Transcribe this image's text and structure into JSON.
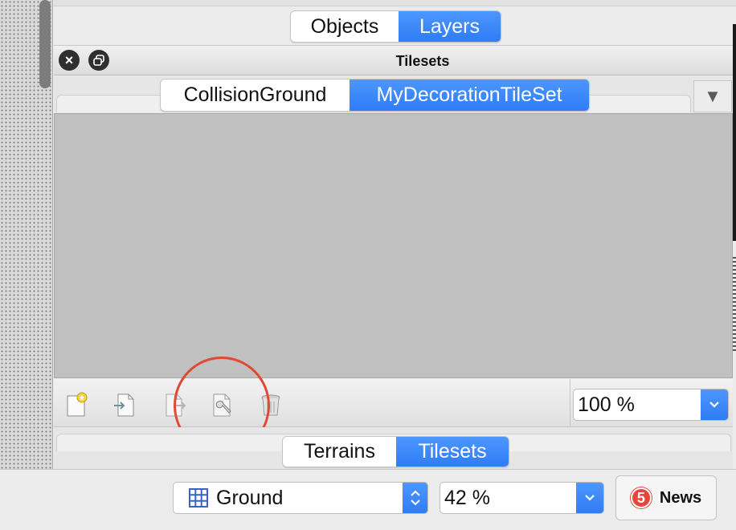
{
  "top_tabs": {
    "items": [
      "Objects",
      "Layers"
    ],
    "active": "Layers"
  },
  "dock": {
    "title": "Tilesets",
    "close_icon": "close-icon",
    "float_icon": "float-icon"
  },
  "tileset_tabs": {
    "items": [
      "CollisionGround",
      "MyDecorationTileSet"
    ],
    "active": "MyDecorationTileSet",
    "menu_glyph": "▼"
  },
  "toolbar": {
    "icons": [
      "new-tileset-icon",
      "import-tileset-icon",
      "export-tileset-icon",
      "tileset-properties-icon",
      "remove-tileset-icon"
    ],
    "zoom": "100 %"
  },
  "bottom_tabs": {
    "items": [
      "Terrains",
      "Tilesets"
    ],
    "active": "Tilesets"
  },
  "status_bar": {
    "layer": "Ground",
    "map_zoom": "42 %",
    "news_count": "5",
    "news_label": "News"
  },
  "colors": {
    "accent": "#3a86ff",
    "highlight_circle": "#e04a35",
    "badge": "#e8453c",
    "tileset_view_bg": "#c0c0c0"
  }
}
